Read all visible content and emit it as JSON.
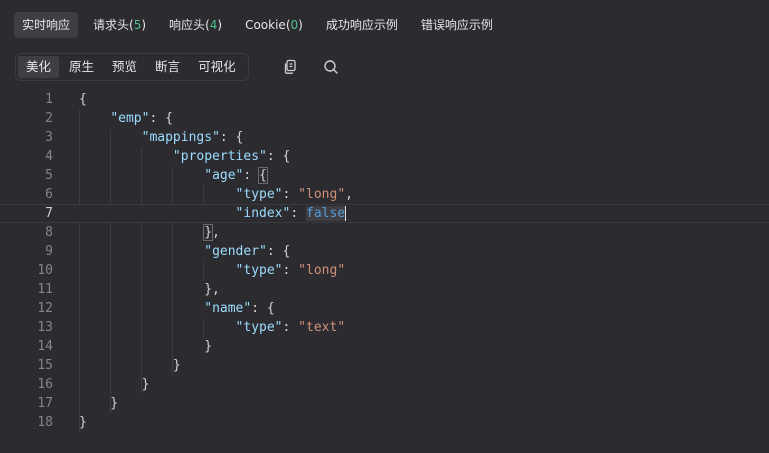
{
  "tabs": [
    {
      "label": "实时响应",
      "count": ""
    },
    {
      "label": "请求头",
      "count": "5"
    },
    {
      "label": "响应头",
      "count": "4"
    },
    {
      "label": "Cookie",
      "count": "0"
    },
    {
      "label": "成功响应示例",
      "count": ""
    },
    {
      "label": "错误响应示例",
      "count": ""
    }
  ],
  "view_modes": [
    "美化",
    "原生",
    "预览",
    "断言",
    "可视化"
  ],
  "tools": {
    "copy_icon": "copy-icon",
    "search_icon": "search-icon"
  },
  "line_numbers": [
    "1",
    "2",
    "3",
    "4",
    "5",
    "6",
    "7",
    "8",
    "9",
    "10",
    "11",
    "12",
    "13",
    "14",
    "15",
    "16",
    "17",
    "18"
  ],
  "json": {
    "root": "emp",
    "mappings": "mappings",
    "properties": "properties",
    "fields": [
      {
        "name": "age",
        "type": "long",
        "index": "false"
      },
      {
        "name": "gender",
        "type": "long"
      },
      {
        "name": "name",
        "type": "text"
      }
    ]
  },
  "colors": {
    "accent": "#4fc08d",
    "key": "#9cdcfe",
    "string": "#ce9178",
    "bool": "#569cd6"
  }
}
